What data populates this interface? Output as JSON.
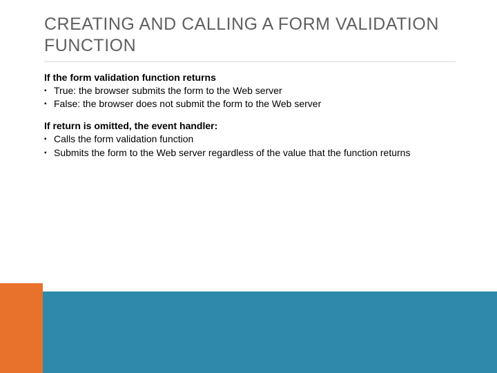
{
  "title": "CREATING AND CALLING A FORM VALIDATION FUNCTION",
  "section1": {
    "lead": "If the form validation function returns",
    "items": [
      "True: the browser submits the form to the Web server",
      "False: the browser does not submit the form to the Web server"
    ]
  },
  "section2": {
    "lead": "If return is omitted, the event handler:",
    "items": [
      "Calls the form validation function",
      "Submits the form to the Web server regardless of the value that the function returns"
    ]
  }
}
